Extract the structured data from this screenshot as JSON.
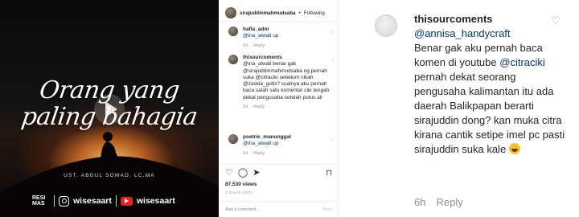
{
  "video": {
    "caption_line1": "Orang yang",
    "caption_line2": "paling bahagia",
    "credit": "UST. ABDUL SOMAD, LC.MA",
    "brand_box": "RESI MAS",
    "instagram_handle": "wisesaart",
    "youtube_handle": "wisesaart"
  },
  "post": {
    "username": "sirajuddinmahmudsaba",
    "separator": "•",
    "follow_label": "Following",
    "comments": [
      {
        "username": "hafla_adni",
        "text": "@ina_alwati up",
        "age": "2d",
        "reply": "Reply"
      },
      {
        "username": "thisourcoments",
        "text": "@ina_alwati benar gak @sirajuddinmahmudsaba ng pernah suka @citraciki sebelum nikah @zaskia_gotix? soalnya aku pernah baca salah satu komentar ciki tengah dekat pengusaha setelah putus ali",
        "age": "1d",
        "reply": "Reply"
      },
      {
        "username": "poetrie_manunggal",
        "text": "@ina_alwati up",
        "age": "1d",
        "reply": "Reply"
      }
    ],
    "views": "87,530 views",
    "time_ago": "2 DAYS AGO",
    "add_comment_placeholder": "Add a comment...",
    "post_label": "Post"
  },
  "zoom_comment": {
    "username": "thisourcoments",
    "mention_1": "@annisa_handycraft",
    "text_part_1": "Benar gak aku pernah baca komen di youtube",
    "mention_2": "@citraciki",
    "text_part_2": "pernah dekat seorang pengusaha kalimantan itu ada daerah Balikpapan berarti sirajuddin dong? kan muka citra kirana cantik setipe imel pc pasti sirajuddin suka kale",
    "age": "6h",
    "reply_label": "Reply"
  },
  "icons": [
    "heart-icon",
    "comment-icon",
    "share-icon",
    "bookmark-icon",
    "play-icon",
    "instagram-icon",
    "youtube-icon",
    "emoji-icon"
  ]
}
